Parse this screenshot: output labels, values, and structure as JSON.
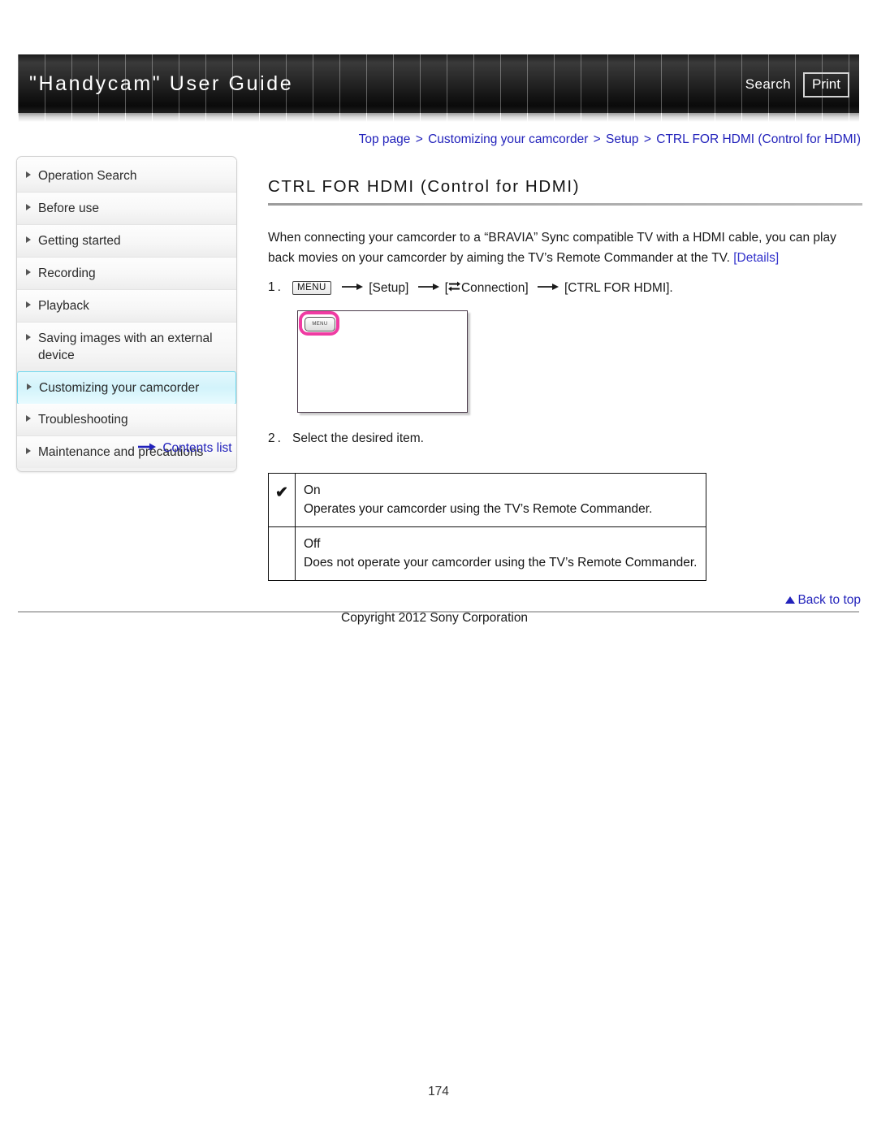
{
  "header": {
    "title": "\"Handycam\" User Guide",
    "search_label": "Search",
    "print_label": "Print"
  },
  "breadcrumb": {
    "items": [
      "Top page",
      "Customizing your camcorder",
      "Setup",
      "CTRL FOR HDMI (Control for HDMI)"
    ],
    "separator": ">",
    "full_text": "Top page > Customizing your camcorder > Setup > CTRL FOR HDMI (Control for HDMI)"
  },
  "sidebar": {
    "items": [
      {
        "label": "Operation Search",
        "active": false
      },
      {
        "label": "Before use",
        "active": false
      },
      {
        "label": "Getting started",
        "active": false
      },
      {
        "label": "Recording",
        "active": false
      },
      {
        "label": "Playback",
        "active": false
      },
      {
        "label": "Saving images with an external device",
        "active": false
      },
      {
        "label": "Customizing your camcorder",
        "active": true
      },
      {
        "label": "Troubleshooting",
        "active": false
      },
      {
        "label": "Maintenance and precautions",
        "active": false
      }
    ],
    "contents_list_label": "Contents list",
    "contents_list_icon": "right-arrow-icon",
    "active_accent": "#6fd8ee"
  },
  "main": {
    "page_title": "CTRL FOR HDMI (Control for HDMI)",
    "intro_text": "When connecting your camcorder to a “BRAVIA” Sync compatible TV with a HDMI cable, you can play back movies on your camcorder by aiming the TV’s Remote Commander at the TV. ",
    "details_link_label": "[Details]",
    "step1": {
      "number": "1.",
      "menu_chip_label": "MENU",
      "arrow": "→",
      "part1": "[Setup]",
      "connection_icon": "exchange-arrows-icon",
      "part2": "Connection]",
      "part2_prefix": "[",
      "part3": "[CTRL FOR HDMI]."
    },
    "illustration": {
      "menu_button_label": "MENU",
      "highlight_color": "#ef3ba2"
    },
    "step2": {
      "number": "2.",
      "text": "Select the desired item."
    },
    "options": [
      {
        "checked": true,
        "check_glyph": "✔",
        "name": "On",
        "description": "Operates your camcorder using the TV’s Remote Commander."
      },
      {
        "checked": false,
        "check_glyph": "",
        "name": "Off",
        "description": "Does not operate your camcorder using the TV’s Remote Commander."
      }
    ]
  },
  "footer": {
    "back_to_top_label": "Back to top",
    "back_to_top_icon": "up-triangle-icon",
    "copyright": "Copyright 2012 Sony Corporation",
    "page_number": "174"
  }
}
